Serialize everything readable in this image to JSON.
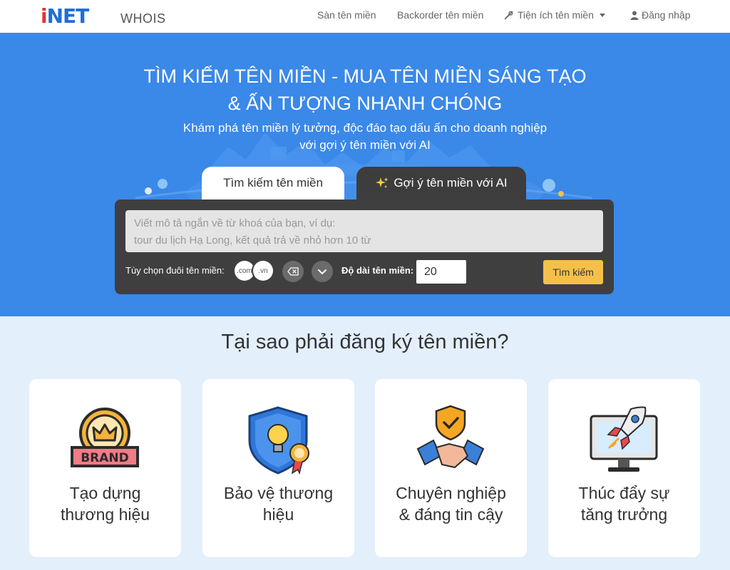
{
  "nav": {
    "logo_i": "i",
    "logo_net": "NET",
    "logo_suffix": "WHOIS",
    "links": [
      "Sàn tên miền",
      "Backorder tên miền",
      "Tiện ích tên miền",
      "Đăng nhập"
    ]
  },
  "hero": {
    "title_line1": "TÌM KIẾM TÊN MIỀN - MUA TÊN MIỀN SÁNG TẠO",
    "title_line2": "& ẤN TƯỢNG NHANH CHÓNG",
    "sub_line1": "Khám phá tên miền lý tưởng, độc đáo tạo dấu ấn cho doanh nghiệp",
    "sub_line2": "với gợi ý tên miền với AI",
    "tabs": [
      "Tìm kiếm tên miền",
      "Gợi ý tên miền với AI"
    ]
  },
  "search_panel": {
    "placeholder_line1": "Viết mô tả ngắn về từ khoá của bạn, ví dụ:",
    "placeholder_line2": "tour du lịch Hạ Long, kết quả trả về nhỏ hơn 10 từ",
    "extension_label": "Tùy chọn đuôi tên miền:",
    "extensions": [
      ".com",
      ".vn"
    ],
    "length_label": "Độ dài tên miền:",
    "length_value": "20",
    "search_button": "Tìm kiếm"
  },
  "why": {
    "title": "Tại sao phải đăng ký tên miền?",
    "brand_badge": "BRAND",
    "cards": [
      {
        "line1": "Tạo dựng",
        "line2": "thương hiệu",
        "icon": "brand-crown-icon"
      },
      {
        "line1": "Bảo vệ thương",
        "line2": "hiệu",
        "icon": "shield-bulb-icon"
      },
      {
        "line1": "Chuyên nghiệp",
        "line2": "& đáng tin cậy",
        "icon": "handshake-shield-icon"
      },
      {
        "line1": "Thúc đẩy sự",
        "line2": "tăng trưởng",
        "icon": "rocket-monitor-icon"
      }
    ]
  },
  "colors": {
    "hero_bg": "#3a88e8",
    "panel_bg": "#3f3f3f",
    "search_button": "#f4c04a",
    "section_bg": "#e3effb",
    "logo_red": "#e8312f",
    "logo_blue": "#1e6fd9"
  }
}
